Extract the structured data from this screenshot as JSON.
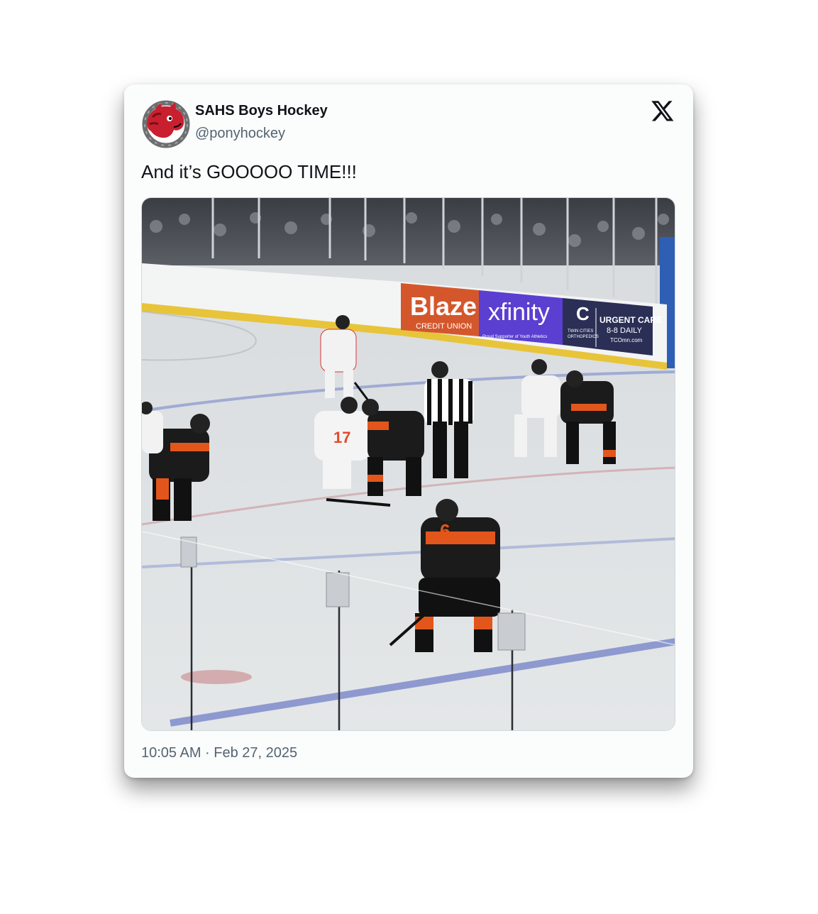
{
  "post": {
    "author": {
      "display_name": "SAHS Boys Hockey",
      "handle": "@ponyhockey",
      "avatar_icon": "pony-mascot-avatar"
    },
    "platform_icon": "x-logo-icon",
    "text": "And it’s GOOOOO TIME!!!",
    "timestamp": "10:05 AM · Feb 27, 2025"
  },
  "media": {
    "description_icon": "hockey-faceoff-photo",
    "ads": {
      "blaze": "Blaze",
      "blaze_sub": "CREDIT UNION",
      "xfinity": "xfinity",
      "xfinity_sub": "Proud Supporter of Youth Athletics",
      "tco_line1": "TWIN CITIES",
      "tco_line2": "ORTHOPEDICS",
      "urgent": "URGENT CARE",
      "daily": "8-8 DAILY",
      "tco_url": "TCOmn.com"
    },
    "jersey_numbers": {
      "white_center": "17",
      "orange_back": "6"
    }
  },
  "colors": {
    "name_text": "#0f1419",
    "secondary_text": "#536471",
    "blaze_orange": "#d4572c",
    "xfinity_purple": "#5a3fd0",
    "tco_navy": "#2b2f55",
    "team_orange": "#e2561b"
  }
}
